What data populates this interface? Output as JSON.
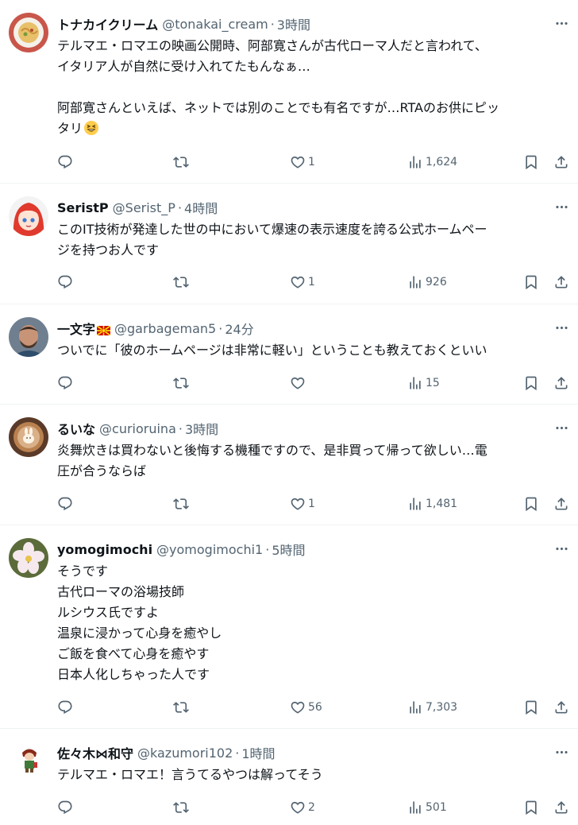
{
  "tweets": [
    {
      "name": "トナカイクリーム",
      "handle": "@tonakai_cream",
      "time": "3時間",
      "lines": [
        "テルマエ・ロマエの映画公開時、阿部寛さんが古代ローマ人だと言われて、",
        "イタリア人が自然に受け入れてたもんなぁ…",
        "",
        "阿部寛さんといえば、ネットでは別のことでも有名ですが…RTAのお供にピッ",
        "タリ"
      ],
      "emoji": "grinning-squinting-face",
      "likes": "1",
      "views": "1,624"
    },
    {
      "name": "SeristP",
      "handle": "@Serist_P",
      "time": "4時間",
      "lines": [
        "このIT技術が発達した世の中において爆速の表示速度を誇る公式ホームペー",
        "ジを持つお人です"
      ],
      "likes": "1",
      "views": "926"
    },
    {
      "name": "一文字",
      "flag": "north-macedonia-flag",
      "handle": "@garbageman5",
      "time": "24分",
      "lines": [
        "ついでに「彼のホームページは非常に軽い」ということも教えておくといい"
      ],
      "likes": "",
      "views": "15"
    },
    {
      "name": "るいな",
      "handle": "@curioruina",
      "time": "3時間",
      "lines": [
        "炎舞炊きは買わないと後悔する機種ですので、是非買って帰って欲しい…電",
        "圧が合うならば"
      ],
      "likes": "1",
      "views": "1,481"
    },
    {
      "name": "yomogimochi",
      "handle": "@yomogimochi1",
      "time": "5時間",
      "lines": [
        "そうです",
        "古代ローマの浴場技師",
        "ルシウス氏ですよ",
        "温泉に浸かって心身を癒やし",
        "ご飯を食べて心身を癒やす",
        "日本人化しちゃった人です"
      ],
      "likes": "56",
      "views": "7,303"
    },
    {
      "name": "佐々木⋈和守",
      "handle": "@kazumori102",
      "time": "1時間",
      "lines": [
        "テルマエ・ロマエ！言うてるやつは解ってそう"
      ],
      "likes": "2",
      "views": "501"
    }
  ],
  "icons": [
    "reply-icon",
    "retweet-icon",
    "like-icon",
    "views-icon",
    "bookmark-icon",
    "share-icon",
    "more-icon"
  ],
  "colors": {
    "text": "#0f1419",
    "secondary": "#536471",
    "divider": "#eff3f4"
  }
}
